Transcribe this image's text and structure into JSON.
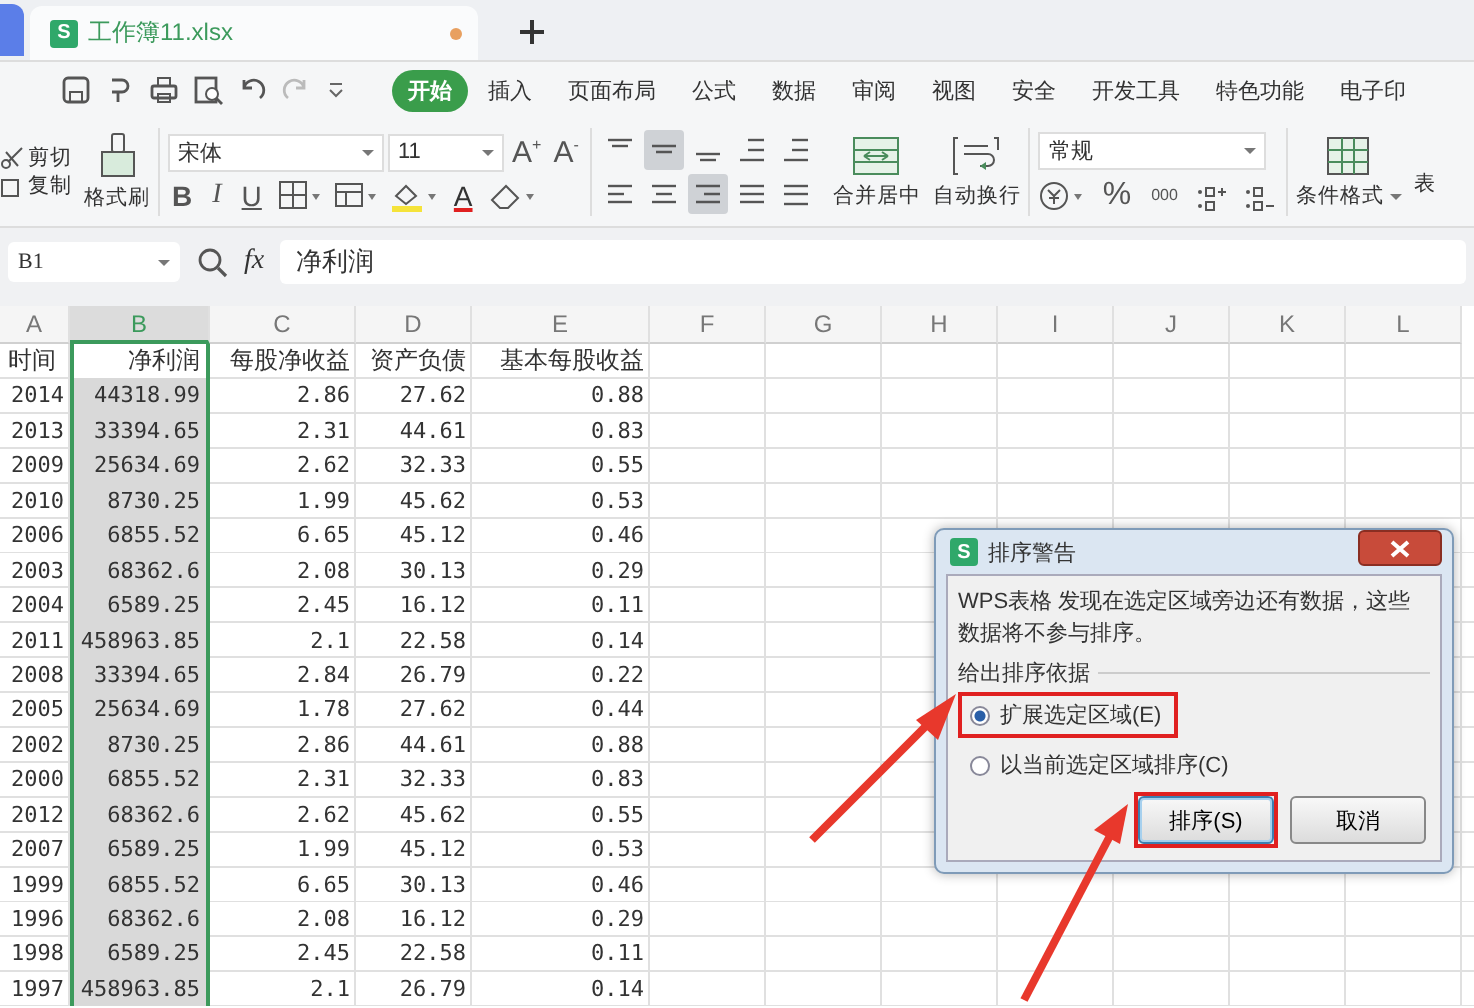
{
  "document_tab": {
    "title": "工作簿11.xlsx",
    "icon_letter": "S",
    "unsaved": true
  },
  "menu": [
    {
      "label": "开始",
      "selected": true
    },
    {
      "label": "插入",
      "selected": false
    },
    {
      "label": "页面布局",
      "selected": false
    },
    {
      "label": "公式",
      "selected": false
    },
    {
      "label": "数据",
      "selected": false
    },
    {
      "label": "审阅",
      "selected": false
    },
    {
      "label": "视图",
      "selected": false
    },
    {
      "label": "安全",
      "selected": false
    },
    {
      "label": "开发工具",
      "selected": false
    },
    {
      "label": "特色功能",
      "selected": false
    },
    {
      "label": "电子印",
      "selected": false
    }
  ],
  "ribbon": {
    "clipboard": [
      {
        "label": "剪切",
        "kind": "cut"
      },
      {
        "label": "复制",
        "kind": "copy"
      }
    ],
    "format_painter": "格式刷",
    "font_name": "宋体",
    "font_size": "11",
    "font_size_buttons": [
      {
        "label": "A",
        "sign": "+"
      },
      {
        "label": "A",
        "sign": "-"
      }
    ],
    "style_buttons": [
      {
        "label": "B",
        "kind": "bold"
      },
      {
        "label": "I",
        "kind": "italic"
      },
      {
        "label": "U",
        "kind": "underline"
      }
    ],
    "font_color_button": "A",
    "alignment": [
      {
        "kind": "top",
        "selected": false
      },
      {
        "kind": "middle",
        "selected": true
      },
      {
        "kind": "bottom",
        "selected": false
      },
      {
        "kind": "outdent",
        "selected": false
      },
      {
        "kind": "indent",
        "selected": false
      },
      {
        "kind": "left",
        "selected": false
      },
      {
        "kind": "center",
        "selected": false
      },
      {
        "kind": "right",
        "selected": true
      },
      {
        "kind": "justify",
        "selected": false
      },
      {
        "kind": "distributed",
        "selected": false
      }
    ],
    "merge": "合并居中",
    "wrap": "自动换行",
    "number_format": "常规",
    "percent": "%",
    "thousands": "000",
    "conditional_format": "条件格式",
    "cut_off": "表"
  },
  "formula_bar": {
    "cell": "B1",
    "fx": "fx",
    "value": "净利润"
  },
  "columns": [
    {
      "label": "A",
      "selected": false
    },
    {
      "label": "B",
      "selected": true
    },
    {
      "label": "C",
      "selected": false
    },
    {
      "label": "D",
      "selected": false
    },
    {
      "label": "E",
      "selected": false
    },
    {
      "label": "F",
      "selected": false
    },
    {
      "label": "G",
      "selected": false
    },
    {
      "label": "H",
      "selected": false
    },
    {
      "label": "I",
      "selected": false
    },
    {
      "label": "J",
      "selected": false
    },
    {
      "label": "K",
      "selected": false
    },
    {
      "label": "L",
      "selected": false
    }
  ],
  "rows": [
    [
      "时间",
      "净利润",
      "每股净收益",
      "资产负债",
      "基本每股收益"
    ],
    [
      "2014",
      "44318.99",
      "2.86",
      "27.62",
      "0.88"
    ],
    [
      "2013",
      "33394.65",
      "2.31",
      "44.61",
      "0.83"
    ],
    [
      "2009",
      "25634.69",
      "2.62",
      "32.33",
      "0.55"
    ],
    [
      "2010",
      "8730.25",
      "1.99",
      "45.62",
      "0.53"
    ],
    [
      "2006",
      "6855.52",
      "6.65",
      "45.12",
      "0.46"
    ],
    [
      "2003",
      "68362.6",
      "2.08",
      "30.13",
      "0.29"
    ],
    [
      "2004",
      "6589.25",
      "2.45",
      "16.12",
      "0.11"
    ],
    [
      "2011",
      "458963.85",
      "2.1",
      "22.58",
      "0.14"
    ],
    [
      "2008",
      "33394.65",
      "2.84",
      "26.79",
      "0.22"
    ],
    [
      "2005",
      "25634.69",
      "1.78",
      "27.62",
      "0.44"
    ],
    [
      "2002",
      "8730.25",
      "2.86",
      "44.61",
      "0.88"
    ],
    [
      "2000",
      "6855.52",
      "2.31",
      "32.33",
      "0.83"
    ],
    [
      "2012",
      "68362.6",
      "2.62",
      "45.62",
      "0.55"
    ],
    [
      "2007",
      "6589.25",
      "1.99",
      "45.12",
      "0.53"
    ],
    [
      "1999",
      "6855.52",
      "6.65",
      "30.13",
      "0.46"
    ],
    [
      "1996",
      "68362.6",
      "2.08",
      "16.12",
      "0.29"
    ],
    [
      "1998",
      "6589.25",
      "2.45",
      "22.58",
      "0.11"
    ],
    [
      "1997",
      "458963.85",
      "2.1",
      "26.79",
      "0.14"
    ]
  ],
  "dialog": {
    "icon_letter": "S",
    "title": "排序警告",
    "message": "WPS表格 发现在选定区域旁边还有数据，这些数据将不参与排序。",
    "group_label": "给出排序依据",
    "options": [
      {
        "label": "扩展选定区域(E)",
        "selected": true,
        "highlighted": true
      },
      {
        "label": "以当前选定区域排序(C)",
        "selected": false,
        "highlighted": false
      }
    ],
    "buttons": [
      {
        "label": "排序(S)",
        "kind": "default",
        "highlighted": true
      },
      {
        "label": "取消",
        "kind": "normal",
        "highlighted": false
      }
    ]
  }
}
